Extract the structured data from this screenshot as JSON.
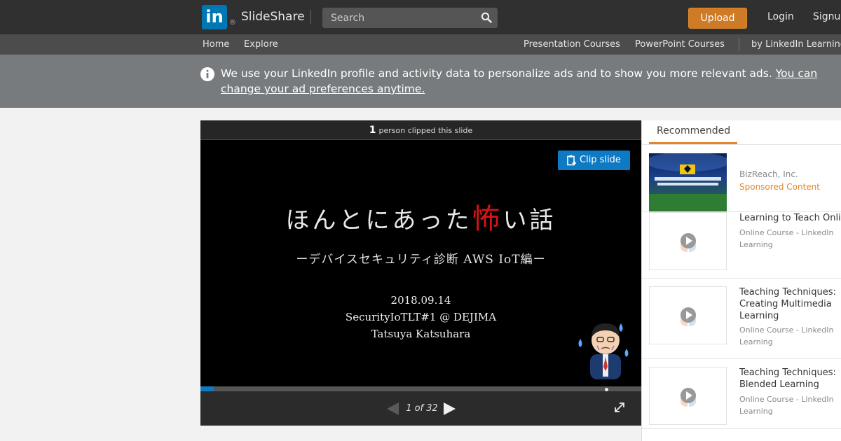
{
  "header": {
    "logo_text": "in",
    "logo_reg": "®",
    "brand": "SlideShare",
    "search_placeholder": "Search",
    "upload_label": "Upload",
    "login_label": "Login",
    "signup_label": "Signup"
  },
  "subnav": {
    "left": [
      "Home",
      "Explore"
    ],
    "right": [
      "Presentation Courses",
      "PowerPoint Courses",
      "by LinkedIn Learning"
    ]
  },
  "banner": {
    "text": "We use your LinkedIn profile and activity data to personalize ads and to show you more relevant ads.",
    "link": "You can change your ad preferences anytime."
  },
  "player": {
    "clip_count": "1",
    "clip_text": "person clipped this slide",
    "clip_button": "Clip slide",
    "slide": {
      "title_a": "ほんとにあった",
      "title_red": "怖",
      "title_b": "い話",
      "subtitle": "ーデバイスセキュリティ診断 AWS IoT編ー",
      "date": "2018.09.14",
      "event": "SecurityIoTLT#1 @ DEJIMA",
      "author": "Tatsuya Katsuhara"
    },
    "current_page": 1,
    "total_pages": 32,
    "page_indicator": "1 of 32",
    "progress_fraction": 0.03
  },
  "sidebar": {
    "tab_label": "Recommended",
    "items": [
      {
        "title": "",
        "subtitle": "BizReach, Inc.",
        "badge": "Sponsored Content",
        "thumb": "ad-banner"
      },
      {
        "title": "Learning to Teach Online",
        "subtitle": "Online Course - LinkedIn Learning",
        "thumb": "video"
      },
      {
        "title": "Teaching Techniques: Creating Multimedia Learning",
        "subtitle": "Online Course - LinkedIn Learning",
        "thumb": "video"
      },
      {
        "title": "Teaching Techniques: Blended Learning",
        "subtitle": "Online Course - LinkedIn Learning",
        "thumb": "video"
      }
    ]
  },
  "colors": {
    "topbar": "#303030",
    "subnav": "#4c4c4c",
    "banner": "#777b7e",
    "linkedin_blue": "#0077b5",
    "upload_orange": "#cf7a25",
    "clip_blue": "#0e7ac4",
    "accent_orange": "#e0882e"
  }
}
